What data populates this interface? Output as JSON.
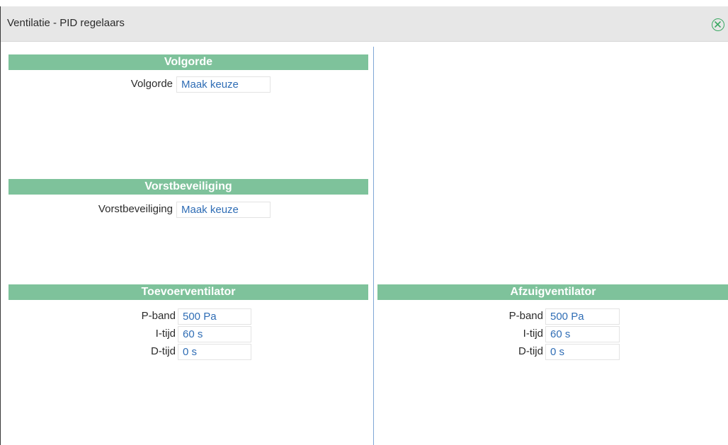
{
  "dialog": {
    "title": "Ventilatie - PID regelaars",
    "close_icon": "close-circle-icon"
  },
  "colors": {
    "section_bar": "#7ec29b",
    "field_text": "#2f6db5",
    "divider": "#7fa6d6",
    "close_icon": "#3aa862"
  },
  "sections": {
    "volgorde": {
      "title": "Volgorde",
      "rows": [
        {
          "label": "Volgorde",
          "value": "Maak keuze"
        }
      ]
    },
    "vorst": {
      "title": "Vorstbeveiliging",
      "rows": [
        {
          "label": "Vorstbeveiliging",
          "value": "Maak keuze"
        }
      ]
    },
    "toevoer": {
      "title": "Toevoerventilator",
      "rows": [
        {
          "label": "P-band",
          "value": "500 Pa"
        },
        {
          "label": "I-tijd",
          "value": "60 s"
        },
        {
          "label": "D-tijd",
          "value": "0 s"
        }
      ]
    },
    "afzuig": {
      "title": "Afzuigventilator",
      "rows": [
        {
          "label": "P-band",
          "value": "500 Pa"
        },
        {
          "label": "I-tijd",
          "value": "60 s"
        },
        {
          "label": "D-tijd",
          "value": "0 s"
        }
      ]
    }
  }
}
